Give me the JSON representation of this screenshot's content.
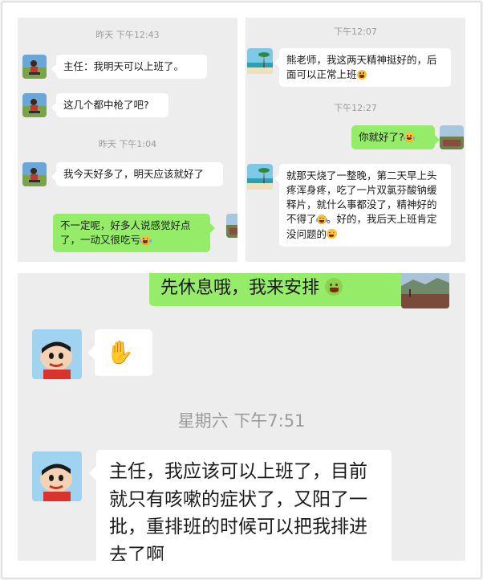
{
  "panel_a": {
    "time1": "昨天 下午12:43",
    "msg1": "主任：我明天可以上班了。",
    "msg2": "这几个都中枪了吧?",
    "time2": "昨天 下午1:04",
    "msg3": "我今天好多了，明天应该就好了",
    "msg4": "不一定呢，好多人说感觉好点了，一动又很吃亏"
  },
  "panel_b": {
    "time1": "下午12:07",
    "msg1": "熊老师，我这两天精神挺好的，后面可以正常上班",
    "time2": "下午12:27",
    "msg2": "你就好了?",
    "msg3": "就那天烧了一整晚，第二天早上头疼浑身疼，吃了一片双氯芬酸钠缓释片，就什么事都没了，精神好的不得了",
    "msg3b": "。好的，我后天上班肯定没问题的"
  },
  "panel_c": {
    "msg1": "先休息哦，我来安排",
    "msg2_icon": "ok-hand-icon",
    "time1": "星期六 下午7:51",
    "msg3": "主任，我应该可以上班了，目前就只有咳嗽的症状了，又阳了一批，重排班的时候可以把我排进去了啊"
  },
  "colors": {
    "background": "#ededed",
    "bubble_out": "#95ec69",
    "bubble_in": "#ffffff",
    "time": "#9b9b9b"
  }
}
